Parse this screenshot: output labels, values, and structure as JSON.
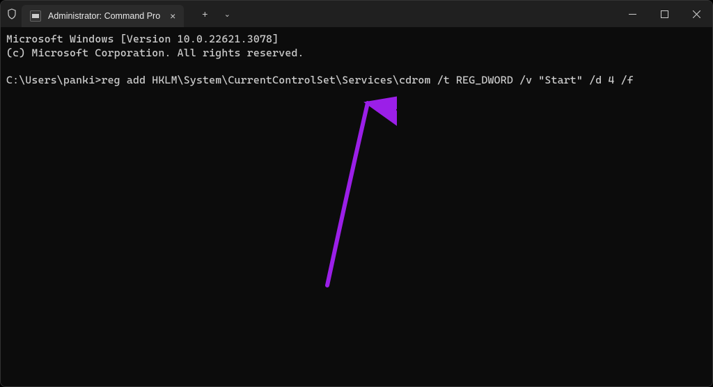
{
  "titlebar": {
    "tab_title": "Administrator: Command Pro"
  },
  "terminal": {
    "line1": "Microsoft Windows [Version 10.0.22621.3078]",
    "line2": "(c) Microsoft Corporation. All rights reserved.",
    "blank": "",
    "prompt": "C:\\Users\\panki>",
    "command": "reg add HKLM\\System\\CurrentControlSet\\Services\\cdrom /t REG_DWORD /v \"Start\" /d 4 /f"
  },
  "icons": {
    "close_x": "×",
    "plus": "+",
    "chevron_down": "⌄",
    "minimize": "—",
    "maximize": "☐",
    "window_close": "✕"
  }
}
